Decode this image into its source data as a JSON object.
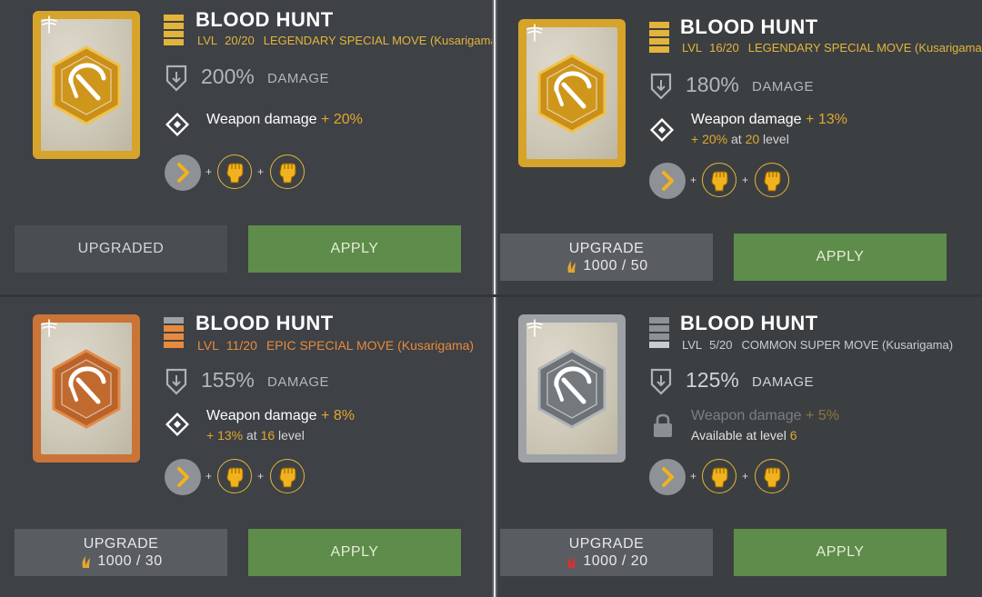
{
  "cards": [
    {
      "title": "BLOOD HUNT",
      "lvl_label": "LVL",
      "level": "20/20",
      "type": "LEGENDARY SPECIAL MOVE (Kusarigama)",
      "rarity": "legendary",
      "damage_pct": "200%",
      "damage_label": "DAMAGE",
      "weapon_label": "Weapon damage",
      "weapon_bonus": "+ 20%",
      "next_bonus": "",
      "next_at": "",
      "next_level": "",
      "next_suffix": "",
      "upgrade_label": "UPGRADED",
      "upgrade_cost": "",
      "apply_label": "APPLY"
    },
    {
      "title": "BLOOD HUNT",
      "lvl_label": "LVL",
      "level": "16/20",
      "type": "LEGENDARY SPECIAL MOVE (Kusarigama)",
      "rarity": "legendary",
      "damage_pct": "180%",
      "damage_label": "DAMAGE",
      "weapon_label": "Weapon damage",
      "weapon_bonus": "+ 13%",
      "next_bonus": "+ 20%",
      "next_at": "at",
      "next_level": "20",
      "next_suffix": "level",
      "upgrade_label": "UPGRADE",
      "upgrade_cost": "1000 / 50",
      "apply_label": "APPLY"
    },
    {
      "title": "BLOOD HUNT",
      "lvl_label": "LVL",
      "level": "11/20",
      "type": "EPIC SPECIAL MOVE (Kusarigama)",
      "rarity": "epic",
      "damage_pct": "155%",
      "damage_label": "DAMAGE",
      "weapon_label": "Weapon damage",
      "weapon_bonus": "+ 8%",
      "next_bonus": "+ 13%",
      "next_at": "at",
      "next_level": "16",
      "next_suffix": "level",
      "upgrade_label": "UPGRADE",
      "upgrade_cost": "1000 / 30",
      "apply_label": "APPLY"
    },
    {
      "title": "BLOOD HUNT",
      "lvl_label": "LVL",
      "level": "5/20",
      "type": "COMMON SUPER MOVE (Kusarigama)",
      "rarity": "common",
      "damage_pct": "125%",
      "damage_label": "DAMAGE",
      "weapon_label": "Weapon damage",
      "weapon_bonus": "+ 5%",
      "locked_text": "Available at level",
      "locked_level": "6",
      "upgrade_label": "UPGRADE",
      "upgrade_cost": "1000 / 20",
      "apply_label": "APPLY"
    }
  ],
  "colors": {
    "legendary": "#d6a42a",
    "epic": "#cb7438",
    "common": "#9ea2a7",
    "apply_green": "#5e8c4a",
    "bonus_gold": "#e3a72f",
    "cost_red_icon": "#d9302f"
  },
  "icons": {
    "card_corner": "dragonfly-icon",
    "move_badge": "kusarigama-sickle-icon",
    "damage": "shield-arrow-icon",
    "weapon": "diamond-icon",
    "lock": "lock-icon",
    "combo_direction": "arrow-right-icon",
    "combo_attack": "fist-icon",
    "currency": "feather-icon"
  }
}
